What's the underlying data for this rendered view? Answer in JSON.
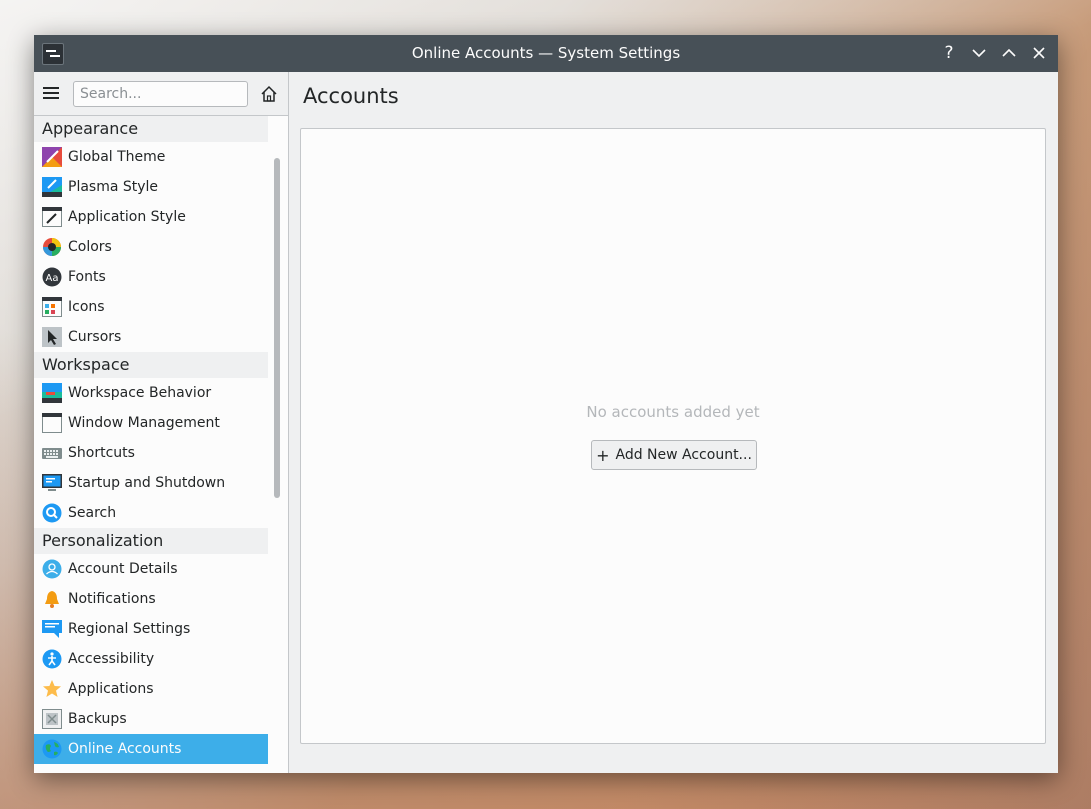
{
  "window": {
    "title": "Online Accounts — System Settings"
  },
  "titlebar_buttons": {
    "help": "?",
    "minimize": "⌄",
    "maximize": "⌃",
    "close": "✕"
  },
  "sidebar": {
    "search_placeholder": "Search...",
    "categories": [
      {
        "label": "Appearance",
        "items": [
          {
            "label": "Global Theme",
            "icon": "global-theme-icon"
          },
          {
            "label": "Plasma Style",
            "icon": "plasma-style-icon"
          },
          {
            "label": "Application Style",
            "icon": "application-style-icon"
          },
          {
            "label": "Colors",
            "icon": "colors-icon"
          },
          {
            "label": "Fonts",
            "icon": "fonts-icon"
          },
          {
            "label": "Icons",
            "icon": "icons-icon"
          },
          {
            "label": "Cursors",
            "icon": "cursors-icon"
          }
        ]
      },
      {
        "label": "Workspace",
        "items": [
          {
            "label": "Workspace Behavior",
            "icon": "workspace-behavior-icon"
          },
          {
            "label": "Window Management",
            "icon": "window-management-icon"
          },
          {
            "label": "Shortcuts",
            "icon": "keyboard-icon"
          },
          {
            "label": "Startup and Shutdown",
            "icon": "monitor-icon"
          },
          {
            "label": "Search",
            "icon": "search-icon"
          }
        ]
      },
      {
        "label": "Personalization",
        "items": [
          {
            "label": "Account Details",
            "icon": "user-icon"
          },
          {
            "label": "Notifications",
            "icon": "bell-icon"
          },
          {
            "label": "Regional Settings",
            "icon": "chat-bubble-icon"
          },
          {
            "label": "Accessibility",
            "icon": "accessibility-icon"
          },
          {
            "label": "Applications",
            "icon": "star-icon"
          },
          {
            "label": "Backups",
            "icon": "backup-icon"
          },
          {
            "label": "Online Accounts",
            "icon": "globe-icon",
            "selected": true
          }
        ]
      }
    ]
  },
  "main": {
    "title": "Accounts",
    "empty_message": "No accounts added yet",
    "add_button_label": "Add New Account...",
    "add_button_icon": "+"
  },
  "colors": {
    "selection": "#3daee9",
    "titlebar": "#475057"
  }
}
